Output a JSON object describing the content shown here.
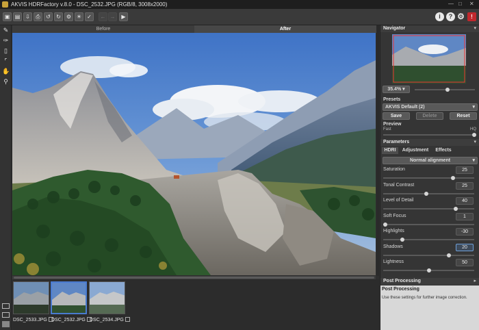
{
  "window": {
    "title": "AKVIS HDRFactory v.8.0 - DSC_2532.JPG (RGB/8, 3008x2000)"
  },
  "canvas": {
    "tab_before": "Before",
    "tab_after": "After",
    "active_tab": "After"
  },
  "filmstrip": [
    {
      "name": "DSC_2533.JPG",
      "selected": false
    },
    {
      "name": "DSC_2532.JPG",
      "selected": true
    },
    {
      "name": "DSC_2534.JPG",
      "selected": false
    }
  ],
  "navigator": {
    "title": "Navigator",
    "zoom": "35.4%",
    "zoom_slider": 0.55
  },
  "presets": {
    "title": "Presets",
    "current": "AKVIS Default (2)",
    "save": "Save",
    "delete": "Delete",
    "reset": "Reset"
  },
  "preview": {
    "title": "Preview",
    "fast": "Fast",
    "hq": "HQ",
    "level": 1.0
  },
  "parameters": {
    "title": "Parameters",
    "tabs": [
      "HDRI",
      "Adjustment",
      "Effects"
    ],
    "active_tab": "HDRI",
    "alignment": "Normal alignment",
    "sliders": [
      {
        "label": "Saturation",
        "value": "25",
        "level": 0.77,
        "active": false
      },
      {
        "label": "Tonal Contrast",
        "value": "25",
        "level": 0.47,
        "active": false
      },
      {
        "label": "Level of Detail",
        "value": "40",
        "level": 0.8,
        "active": false
      },
      {
        "label": "Soft Focus",
        "value": "1",
        "level": 0.02,
        "active": false
      },
      {
        "label": "Highlights",
        "value": "-30",
        "level": 0.21,
        "active": false
      },
      {
        "label": "Shadows",
        "value": "20",
        "level": 0.72,
        "active": true
      },
      {
        "label": "Lightness",
        "value": "50",
        "level": 0.5,
        "active": false
      }
    ]
  },
  "post_processing": {
    "title": "Post Processing",
    "help_title": "Post Processing",
    "help_text": "Use these settings for further image correction."
  },
  "colors": {
    "accent": "#4a7bd0",
    "panel": "#353535",
    "badge_red": "#c0282d"
  }
}
